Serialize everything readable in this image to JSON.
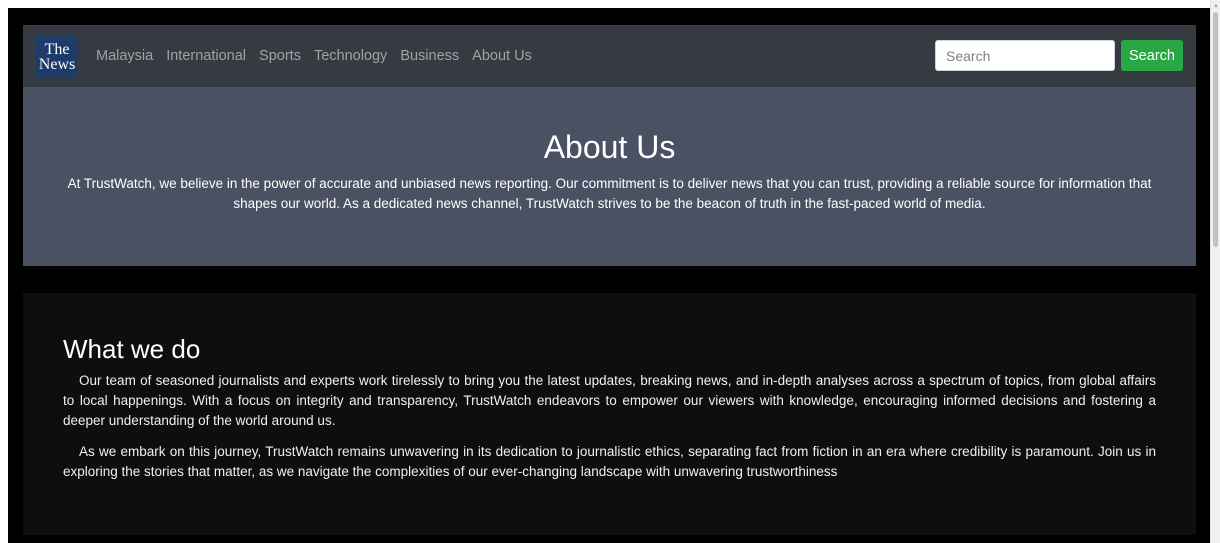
{
  "brand": {
    "logo_line1": "The",
    "logo_line2": "News"
  },
  "nav": {
    "items": [
      {
        "label": "Malaysia"
      },
      {
        "label": "International"
      },
      {
        "label": "Sports"
      },
      {
        "label": "Technology"
      },
      {
        "label": "Business"
      },
      {
        "label": "About Us"
      }
    ]
  },
  "search": {
    "placeholder": "Search",
    "value": "",
    "button_label": "Search"
  },
  "hero": {
    "title": "About Us",
    "text": "At TrustWatch, we believe in the power of accurate and unbiased news reporting. Our commitment is to deliver news that you can trust, providing a reliable source for information that shapes our world. As a dedicated news channel, TrustWatch strives to be the beacon of truth in the fast-paced world of media."
  },
  "section": {
    "title": "What we do",
    "paragraphs": [
      "Our team of seasoned journalists and experts work tirelessly to bring you the latest updates, breaking news, and in-depth analyses across a spectrum of topics, from global affairs to local happenings. With a focus on integrity and transparency, TrustWatch endeavors to empower our viewers with knowledge, encouraging informed decisions and fostering a deeper understanding of the world around us.",
      "As we embark on this journey, TrustWatch remains unwavering in its dedication to journalistic ethics, separating fact from fiction in an era where credibility is paramount. Join us in exploring the stories that matter, as we navigate the complexities of our ever-changing landscape with unwavering trustworthiness"
    ]
  },
  "colors": {
    "navbar_bg": "#363a41",
    "hero_bg": "#4a5163",
    "content_bg": "#0e0e0f",
    "page_bg": "#000000",
    "search_button_bg": "#28a745",
    "logo_bg": "#1e3c69"
  }
}
